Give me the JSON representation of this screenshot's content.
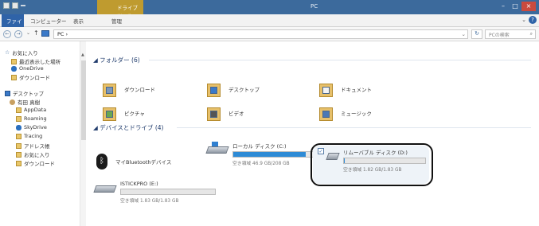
{
  "titlebar": {
    "context_tab": "ドライブ ツール",
    "title": "PC",
    "buttons": [
      "–",
      "□",
      "×"
    ]
  },
  "ribbon": {
    "tabs": [
      "ファイル",
      "コンピューター",
      "表示",
      "管理"
    ],
    "expand": "⌄",
    "help": "?"
  },
  "address": {
    "back": "←",
    "forward": "→",
    "up": "↑",
    "path": "PC",
    "path_sep": "›",
    "dropdown": "⌄",
    "refresh": "↻",
    "search_placeholder": "PCの検索",
    "search_icon": "⌕"
  },
  "nav": {
    "favorites": "お気に入り",
    "recent": "最近表示した場所",
    "onedrive": "OneDrive",
    "downloads": "ダウンロード",
    "desktop": "デスクトップ",
    "user": "有田 真樹",
    "appdata": "AppData",
    "roaming": "Roaming",
    "skydrive": "SkyDrive",
    "tracing": "Tracing",
    "address_book": "アドレス帳",
    "favorites2": "お気に入り",
    "downloads2": "ダウンロード"
  },
  "content": {
    "folders_header": "フォルダー (6)",
    "folders": [
      "ダウンロード",
      "デスクトップ",
      "ドキュメント",
      "ピクチャ",
      "ビデオ",
      "ミュージック"
    ],
    "devices_header": "デバイスとドライブ (4)",
    "bluetooth": "マイBluetoothデバイス",
    "drive_c": {
      "name": "ローカル ディスク (C:)",
      "capacity": "空き領域 46.9 GB/208 GB",
      "used_fraction": 0.775
    },
    "drive_d": {
      "name": "リムーバブル ディスク (D:)",
      "capacity": "空き領域 1.82 GB/1.83 GB",
      "used_fraction": 0.005
    },
    "drive_e": {
      "name": "ISTICKPRO (E:)",
      "capacity": "空き領域 1.83 GB/1.83 GB",
      "used_fraction": 0.0
    }
  }
}
